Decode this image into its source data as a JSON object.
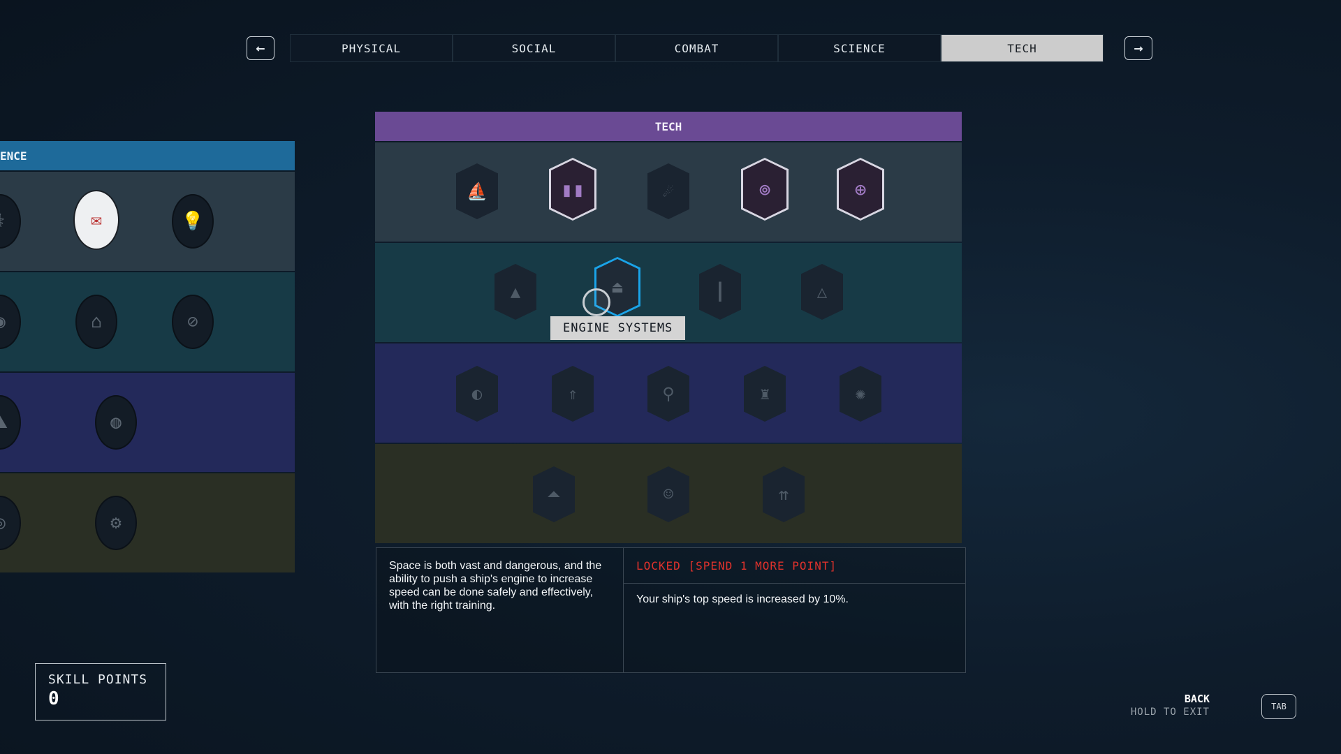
{
  "nav": {
    "prev_icon": "←",
    "next_icon": "→",
    "tabs": [
      {
        "label": "PHYSICAL"
      },
      {
        "label": "SOCIAL"
      },
      {
        "label": "COMBAT"
      },
      {
        "label": "SCIENCE"
      },
      {
        "label": "TECH",
        "active": true
      }
    ]
  },
  "left_tree": {
    "header": "ENCE",
    "header_color": "#1e6a9a",
    "row_colors": [
      "#2b3b47",
      "#173a46",
      "#23295a",
      "#2a2f24"
    ]
  },
  "tree": {
    "header": "TECH",
    "header_color": "#6a4a94",
    "row_colors": [
      "#2b3b47",
      "#173a46",
      "#23295a",
      "#2a2f24"
    ],
    "rows": [
      [
        "ship-icon",
        "jetpack-icon",
        "comet-icon",
        "lock-target-icon",
        "crosshair-icon"
      ],
      [
        "rocket-icon",
        "engine-icon",
        "antenna-icon",
        "triangle-ship-icon"
      ],
      [
        "planet-icon",
        "starship-icon",
        "robot-arm-icon",
        "outpost-icon",
        "gear-icon"
      ],
      [
        "shuttle-icon",
        "astronaut-icon",
        "fleet-icon"
      ]
    ]
  },
  "tooltip": {
    "label": "ENGINE SYSTEMS"
  },
  "description": {
    "text": "Space is both vast and dangerous, and the ability to push a ship's engine to increase speed can be done safely and effectively, with the right training.",
    "status": "LOCKED [SPEND 1 MORE POINT]",
    "status_color": "#e0322c",
    "effect": "Your ship's top speed is increased by 10%."
  },
  "skill_points": {
    "label": "SKILL POINTS",
    "value": "0"
  },
  "footer": {
    "back_label": "BACK",
    "exit_label": "HOLD TO EXIT",
    "key_label": "TAB"
  }
}
